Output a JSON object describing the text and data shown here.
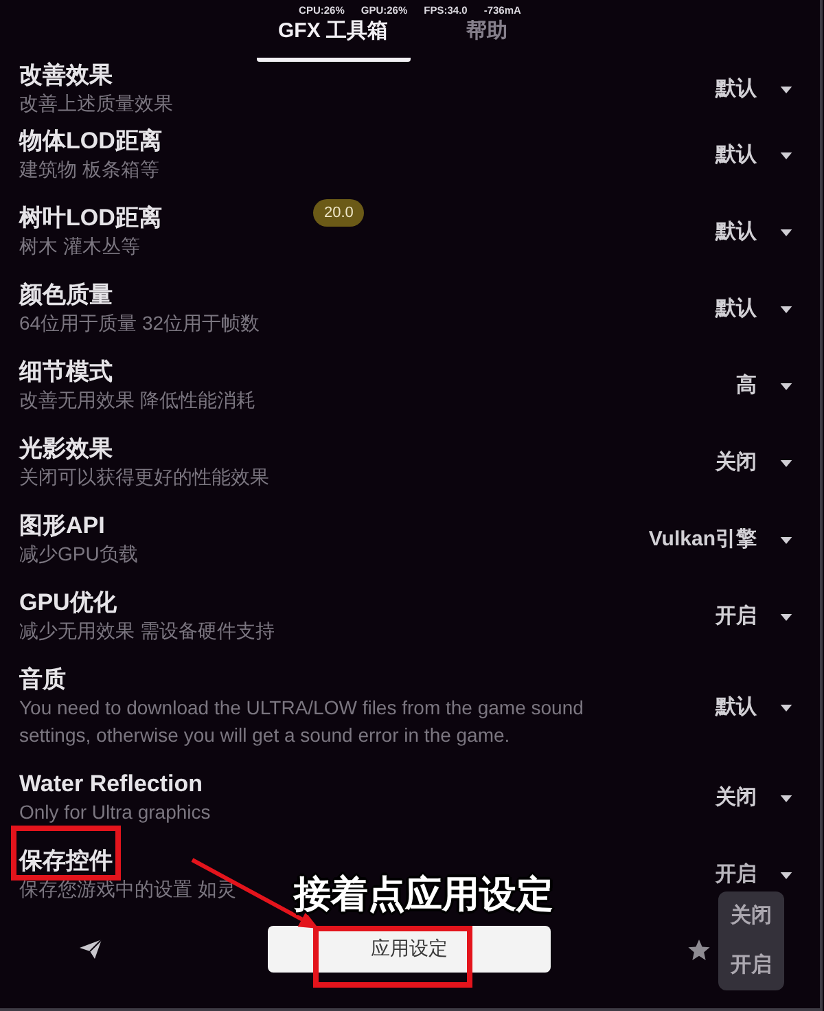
{
  "status_line": [
    "CPU:26%",
    "GPU:26%",
    "FPS:34.0",
    "-736mA"
  ],
  "tabs": [
    {
      "label": "GFX 工具箱",
      "selected": true
    },
    {
      "label": "帮助",
      "selected": false
    }
  ],
  "settings": [
    {
      "title": "改善效果",
      "subtitle": "改善上述质量效果",
      "value": "默认",
      "highlighted": false,
      "expanded": false
    },
    {
      "title": "物体LOD距离",
      "subtitle": "建筑物 板条箱等",
      "value": "默认",
      "highlighted": false,
      "expanded": false
    },
    {
      "title": "树叶LOD距离",
      "subtitle": "树木 灌木丛等",
      "value": "默认",
      "badge": "20.0",
      "highlighted": false,
      "expanded": false
    },
    {
      "title": "颜色质量",
      "subtitle": "64位用于质量 32位用于帧数",
      "value": "默认",
      "highlighted": false,
      "expanded": false
    },
    {
      "title": "细节模式",
      "subtitle": "改善无用效果 降低性能消耗",
      "value": "高",
      "highlighted": false,
      "expanded": false
    },
    {
      "title": "光影效果",
      "subtitle": "关闭可以获得更好的性能效果",
      "value": "关闭",
      "highlighted": false,
      "expanded": false
    },
    {
      "title": "图形API",
      "subtitle": "减少GPU负载",
      "value": "Vulkan引擎",
      "highlighted": false,
      "expanded": false
    },
    {
      "title": "GPU优化",
      "subtitle": "减少无用效果 需设备硬件支持",
      "value": "开启",
      "highlighted": false,
      "expanded": false
    },
    {
      "title": "音质",
      "subtitle": "You need to download the ULTRA/LOW files from the game sound settings, otherwise you will get a sound error in the game.",
      "value": "默认",
      "highlighted": false,
      "expanded": false
    },
    {
      "title": "Water Reflection",
      "subtitle": "Only for Ultra graphics",
      "value": "关闭",
      "highlighted": false,
      "expanded": false
    },
    {
      "title": "保存控件",
      "subtitle": "保存您游戏中的设置 如灵",
      "value": "开启",
      "highlighted": true,
      "expanded": true,
      "options": [
        "关闭",
        "开启"
      ]
    }
  ],
  "bottom_bar": {
    "apply_button": {
      "label": "应用设定",
      "highlighted": true
    }
  },
  "annotation": {
    "caption": "接着点应用设定"
  }
}
